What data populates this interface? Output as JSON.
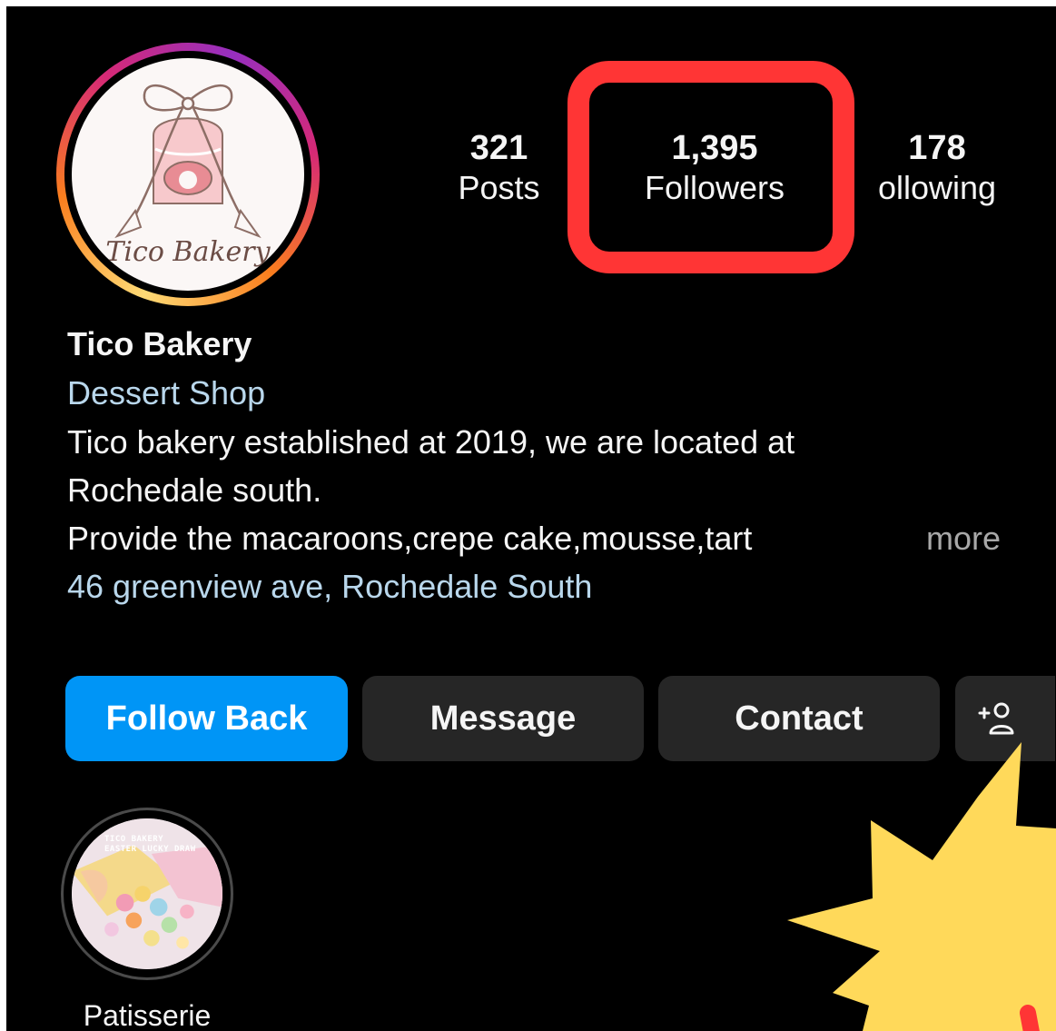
{
  "profile": {
    "logo_text": "Tico Bakery",
    "stats": [
      {
        "value": "321",
        "label": "Posts"
      },
      {
        "value": "1,395",
        "label": "Followers"
      },
      {
        "value": "178",
        "label": "ollowing"
      }
    ],
    "name": "Tico Bakery",
    "category": "Dessert Shop",
    "bio_lines": [
      "Tico bakery established at 2019, we are located at",
      "Rochedale south.",
      "Provide the macaroons,crepe cake,mousse,tart"
    ],
    "more_label": "more",
    "address": "46 greenview ave, Rochedale South"
  },
  "actions": {
    "follow_back": "Follow Back",
    "message": "Message",
    "contact": "Contact"
  },
  "highlights": [
    {
      "label": "Patisserie",
      "cover_text": "TICO BAKERY\nEASTER LUCKY DRAW"
    }
  ],
  "colors": {
    "background": "#000000",
    "accent_blue": "#0095f6",
    "link_blue": "#b9d7ec",
    "highlight_red": "#ff3535",
    "starburst_yellow": "#ffd95a"
  }
}
